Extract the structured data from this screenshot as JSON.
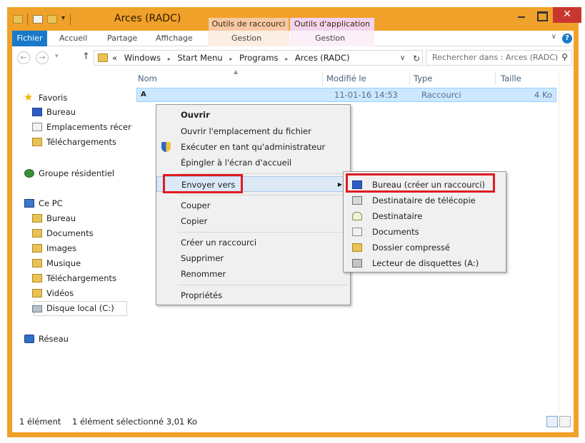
{
  "window": {
    "title": "Arces (RADC)",
    "context_tab_1": "Outils de raccourci",
    "context_tab_2": "Outils d'application",
    "minimize": "minimize",
    "maximize": "maximize",
    "close_glyph": "✕",
    "accent_color": "#f0a12a"
  },
  "ribbon": {
    "tabs": [
      "Fichier",
      "Accueil",
      "Partage",
      "Affichage",
      "Gestion",
      "Gestion"
    ],
    "expand_glyph": "∨",
    "help_glyph": "?"
  },
  "address": {
    "back_glyph": "←",
    "forward_glyph": "→",
    "recent_glyph": "▾",
    "up_glyph": "↑",
    "overflow": "«",
    "crumbs": [
      "Windows",
      "Start Menu",
      "Programs",
      "Arces (RADC)"
    ],
    "crumb_separator": "▸",
    "drop_glyph": "∨",
    "refresh_glyph": "↻",
    "search_placeholder": "Rechercher dans : Arces (RADC)",
    "search_glyph": "⚲"
  },
  "nav": {
    "favoris": "Favoris",
    "bureau": "Bureau",
    "emplacements": "Emplacements récer",
    "telechargements": "Téléchargements",
    "groupe": "Groupe résidentiel",
    "cepc": "Ce PC",
    "pc_bureau": "Bureau",
    "documents": "Documents",
    "images": "Images",
    "musique": "Musique",
    "pc_telechargements": "Téléchargements",
    "videos": "Vidéos",
    "disque": "Disque local (C:)",
    "reseau": "Réseau"
  },
  "columns": {
    "nom": "Nom",
    "modifie": "Modifié le",
    "type": "Type",
    "taille": "Taille"
  },
  "file": {
    "icon_glyph": "A",
    "date": "11-01-16 14:53",
    "type": "Raccourci",
    "size": "4 Ko"
  },
  "context_menu": {
    "ouvrir": "Ouvrir",
    "ouvrir_emplacement": "Ouvrir l'emplacement du fichier",
    "executer_admin": "Exécuter en tant qu'administrateur",
    "epingler": "Épingler à l'écran d'accueil",
    "envoyer_vers": "Envoyer vers",
    "submenu_glyph": "▶",
    "couper": "Couper",
    "copier": "Copier",
    "creer_raccourci": "Créer un raccourci",
    "supprimer": "Supprimer",
    "renommer": "Renommer",
    "proprietes": "Propriétés"
  },
  "submenu": {
    "bureau_raccourci": "Bureau (créer un raccourci)",
    "destinataire_telecopie": "Destinataire de télécopie",
    "destinataire": "Destinataire",
    "documents": "Documents",
    "dossier_compresse": "Dossier compressé",
    "lecteur_disquettes": "Lecteur de disquettes (A:)"
  },
  "status": {
    "count": "1 élément",
    "selected": "1 élément sélectionné 3,01 Ko"
  },
  "highlight_color": "#e01b22"
}
